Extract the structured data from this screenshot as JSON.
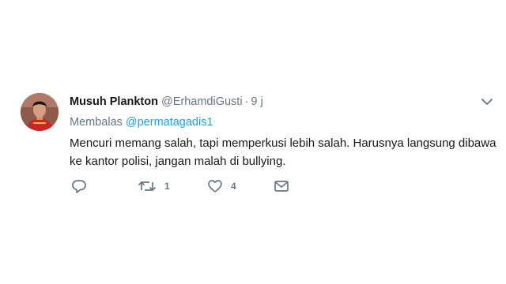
{
  "tweet": {
    "display_name": "Musuh Plankton",
    "handle": "@ErhamdiGusti",
    "separator": "·",
    "time": "9 j",
    "reply_prefix": "Membalas",
    "reply_to": "@permatagadis1",
    "text_line1": "Mencuri memang salah, tapi memperkusi lebih salah. Harusnya langsung dibawa",
    "text_line2": "ke kantor polisi, jangan malah di bullying."
  },
  "actions": {
    "reply_icon": "reply-icon",
    "retweet_icon": "retweet-icon",
    "retweet_count": "1",
    "like_icon": "heart-icon",
    "like_count": "4",
    "dm_icon": "envelope-icon"
  },
  "colors": {
    "text": "#14171a",
    "muted": "#657786",
    "link": "#1da1f2",
    "icon": "#657786"
  }
}
